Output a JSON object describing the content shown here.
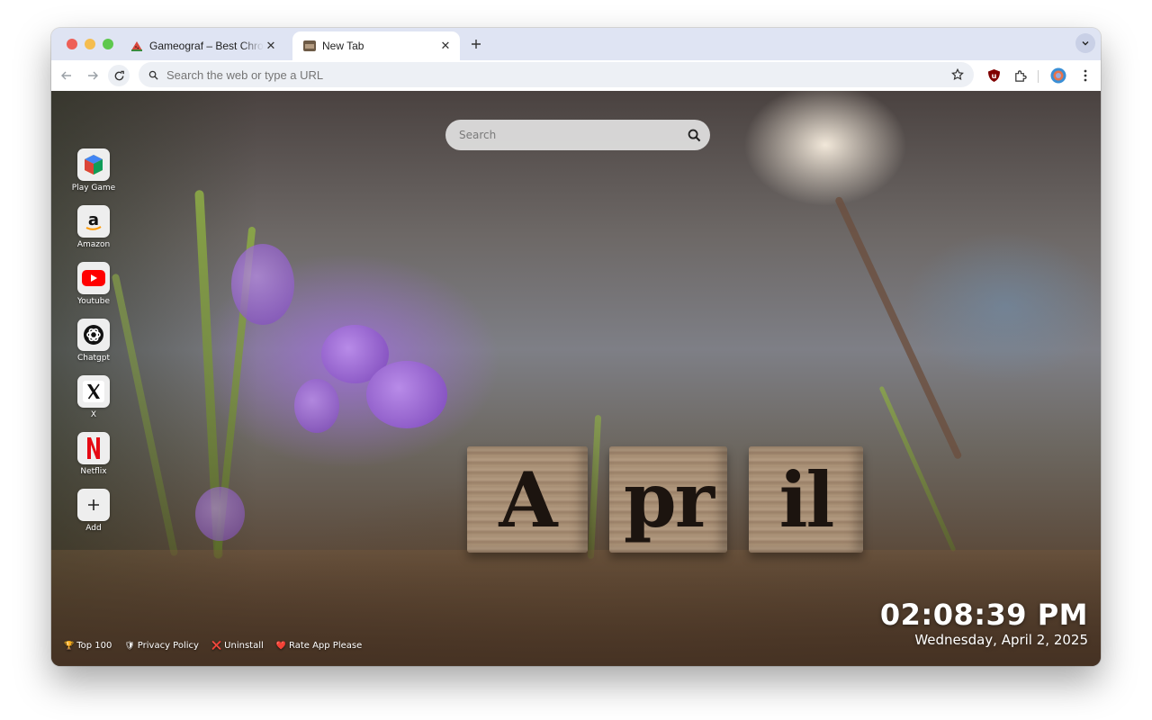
{
  "browser": {
    "tabs": [
      {
        "title": "Gameograf – Best Chrome Li",
        "favicon": "watermelon-icon",
        "active": false
      },
      {
        "title": "New Tab",
        "favicon": "new-tab-thumbnail-icon",
        "active": true
      }
    ],
    "omnibox": {
      "placeholder": "Search the web or type a URL",
      "value": "Search the web or type a URL"
    },
    "extensions": [
      "ublock-icon",
      "puzzle-icon",
      "profile-avatar-icon",
      "kebab-menu-icon"
    ]
  },
  "newtab": {
    "search": {
      "placeholder": "Search"
    },
    "background_text": [
      "A",
      "pr",
      "il"
    ],
    "shortcuts": [
      {
        "label": "Play Game",
        "icon": "cube-icon"
      },
      {
        "label": "Amazon",
        "icon": "amazon-icon"
      },
      {
        "label": "Youtube",
        "icon": "youtube-icon"
      },
      {
        "label": "Chatgpt",
        "icon": "chatgpt-icon"
      },
      {
        "label": "X",
        "icon": "x-logo-icon"
      },
      {
        "label": "Netflix",
        "icon": "netflix-icon"
      },
      {
        "label": "Add",
        "icon": "plus-icon"
      }
    ],
    "footer_links": [
      {
        "emoji": "🏆",
        "label": "Top 100"
      },
      {
        "emoji": "🛡",
        "label": "Privacy Policy"
      },
      {
        "emoji": "❌",
        "label": "Uninstall"
      },
      {
        "emoji": "❤️",
        "label": "Rate App Please"
      }
    ],
    "clock": {
      "time": "02:08:39 PM",
      "date": "Wednesday, April 2, 2025"
    }
  }
}
